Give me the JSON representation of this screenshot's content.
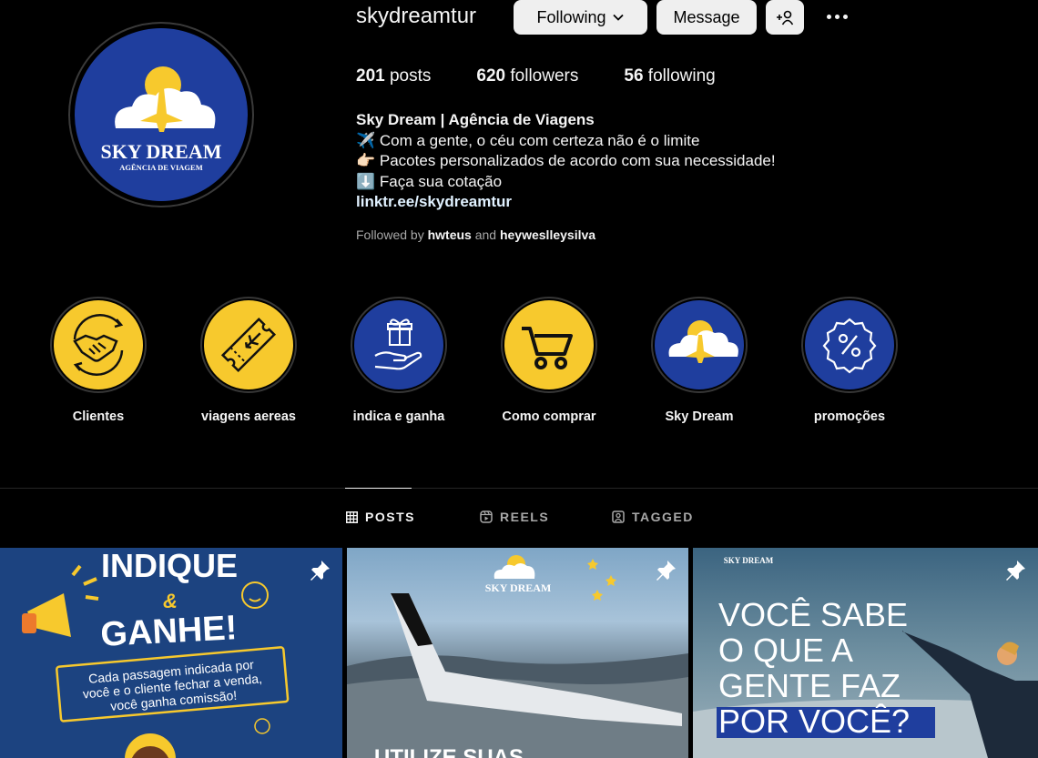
{
  "profile": {
    "username": "skydreamtur",
    "avatar_text_main": "SKY DREAM",
    "avatar_text_sub": "AGÊNCIA DE VIAGEM"
  },
  "actions": {
    "following_label": "Following",
    "message_label": "Message"
  },
  "stats": {
    "posts_count": "201",
    "posts_label": "posts",
    "followers_count": "620",
    "followers_label": "followers",
    "following_count": "56",
    "following_label": "following"
  },
  "bio": {
    "name": "Sky Dream | Agência de Viagens",
    "line1": "✈️ Com a gente, o céu com certeza não é o limite",
    "line2": "👉🏻 Pacotes personalizados de acordo com sua necessidade!",
    "line3": "⬇️ Faça sua cotação",
    "link": "linktr.ee/skydreamtur",
    "followed_by_prefix": "Followed by",
    "followed_by_user1": "hwteus",
    "followed_by_and": "and",
    "followed_by_user2": "heywesllеysilva"
  },
  "highlights": [
    {
      "label": "Clientes",
      "icon": "handshake-icon"
    },
    {
      "label": "viagens aereas",
      "icon": "ticket-icon"
    },
    {
      "label": "indica e ganha",
      "icon": "gift-hand-icon"
    },
    {
      "label": "Como comprar",
      "icon": "cart-icon"
    },
    {
      "label": "Sky Dream",
      "icon": "skydream-logo-icon"
    },
    {
      "label": "promoções",
      "icon": "percent-badge-icon"
    }
  ],
  "tabs": {
    "posts": "POSTS",
    "reels": "REELS",
    "tagged": "TAGGED"
  },
  "posts": {
    "p1_line1": "INDIQUE",
    "p1_amp": "&",
    "p1_line2": "GANHE!",
    "p1_caption": "Cada passagem indicada por você e o cliente fechar a venda, você ganha comissão!",
    "p2_logo": "SKY DREAM",
    "p2_text": "UTILIZE SUAS",
    "p3_logo": "SKY DREAM",
    "p3_line1": "VOCÊ SABE",
    "p3_line2": "O QUE A",
    "p3_line3": "GENTE FAZ",
    "p3_line4": "POR VOCÊ?"
  },
  "colors": {
    "brand_blue": "#1f3e9e",
    "brand_yellow": "#f7c92d",
    "background": "#000000"
  }
}
